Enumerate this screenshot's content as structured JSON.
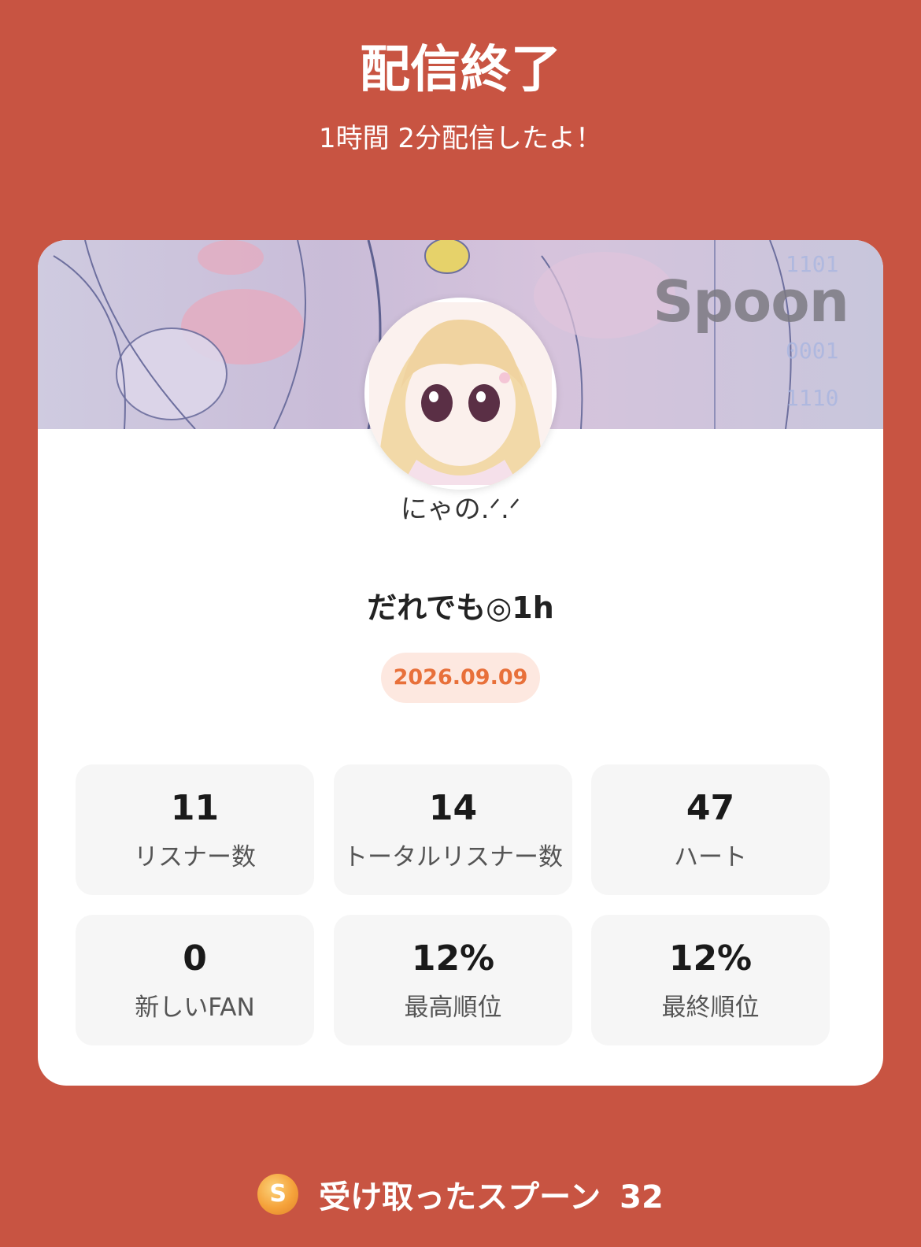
{
  "header": {
    "title": "配信終了",
    "subtitle": "1時間 2分配信したよ！"
  },
  "card": {
    "banner_logo": "Spoon",
    "username": "にゃの.ᐟ.ᐟ",
    "live_title": "だれでも◎1h",
    "date": "2026.09.09",
    "stats": [
      {
        "value": "11",
        "label": "リスナー数"
      },
      {
        "value": "14",
        "label": "トータルリスナー数"
      },
      {
        "value": "47",
        "label": "ハート"
      },
      {
        "value": "0",
        "label": "新しいFAN"
      },
      {
        "value": "12%",
        "label": "最高順位"
      },
      {
        "value": "12%",
        "label": "最終順位"
      }
    ]
  },
  "footer": {
    "icon": "spoon-coin-icon",
    "icon_letter": "S",
    "label": "受け取ったスプーン",
    "count": "32"
  },
  "colors": {
    "background": "#c85442",
    "card": "#ffffff",
    "date_pill_bg": "#fde8e0",
    "date_pill_text": "#e8703a",
    "stat_bg": "#f6f6f6",
    "spoon_coin": "#f5a23a"
  }
}
